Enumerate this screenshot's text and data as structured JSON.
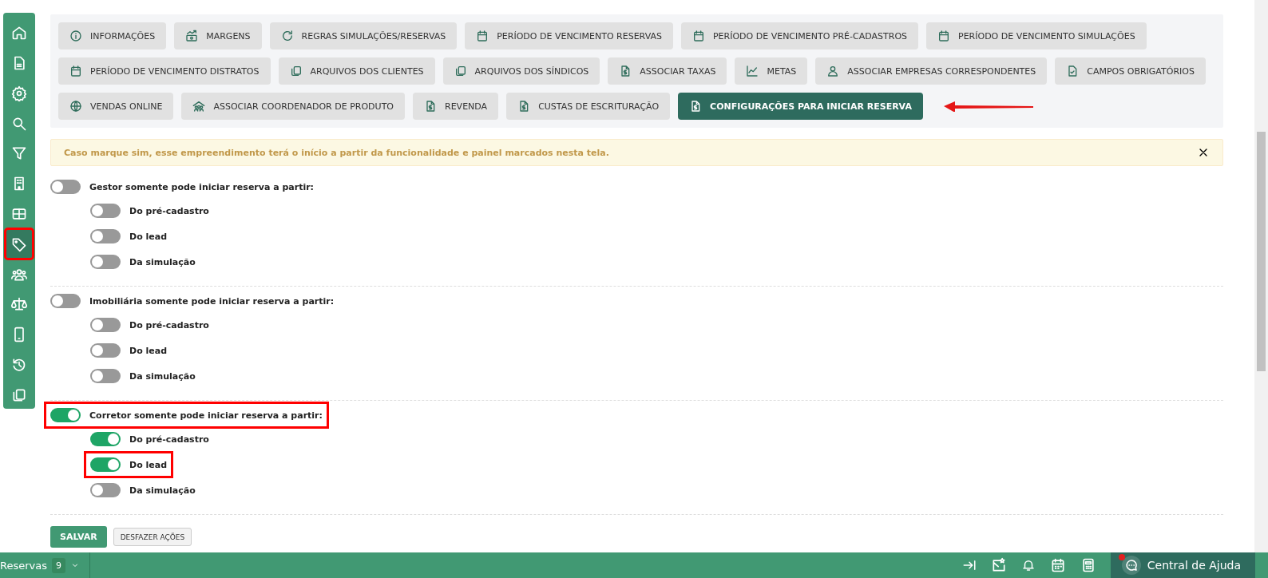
{
  "sidebar": {
    "items": [
      {
        "kind": "home",
        "selected": false,
        "highlighted": false
      },
      {
        "kind": "file",
        "selected": false,
        "highlighted": false
      },
      {
        "kind": "gear",
        "selected": false,
        "highlighted": false
      },
      {
        "kind": "search",
        "selected": false,
        "highlighted": false
      },
      {
        "kind": "filter",
        "selected": false,
        "highlighted": false
      },
      {
        "kind": "building",
        "selected": false,
        "highlighted": false
      },
      {
        "kind": "table",
        "selected": false,
        "highlighted": false
      },
      {
        "kind": "tag",
        "selected": true,
        "highlighted": true
      },
      {
        "kind": "people",
        "selected": false,
        "highlighted": false
      },
      {
        "kind": "scale",
        "selected": false,
        "highlighted": false
      },
      {
        "kind": "phone",
        "selected": false,
        "highlighted": false
      },
      {
        "kind": "history",
        "selected": false,
        "highlighted": false
      },
      {
        "kind": "copy",
        "selected": false,
        "highlighted": false
      }
    ]
  },
  "tabs": [
    {
      "label": "INFORMAÇÕES",
      "kind": "info",
      "selected": false,
      "annotated": false
    },
    {
      "label": "MARGENS",
      "kind": "money",
      "selected": false,
      "annotated": false
    },
    {
      "label": "REGRAS SIMULAÇÕES/RESERVAS",
      "kind": "refresh",
      "selected": false,
      "annotated": false
    },
    {
      "label": "PERÍODO DE VENCIMENTO RESERVAS",
      "kind": "calendar",
      "selected": false,
      "annotated": false
    },
    {
      "label": "PERÍODO DE VENCIMENTO PRÉ-CADASTROS",
      "kind": "calendar",
      "selected": false,
      "annotated": false
    },
    {
      "label": "PERÍODO DE VENCIMENTO SIMULAÇÕES",
      "kind": "calendar",
      "selected": false,
      "annotated": false
    },
    {
      "label": "PERÍODO DE VENCIMENTO DISTRATOS",
      "kind": "calendar",
      "selected": false,
      "annotated": false
    },
    {
      "label": "ARQUIVOS DOS CLIENTES",
      "kind": "copy",
      "selected": false,
      "annotated": false
    },
    {
      "label": "ARQUIVOS DOS SÍNDICOS",
      "kind": "copy",
      "selected": false,
      "annotated": false
    },
    {
      "label": "ASSOCIAR TAXAS",
      "kind": "doc-dollar",
      "selected": false,
      "annotated": false
    },
    {
      "label": "METAS",
      "kind": "chart",
      "selected": false,
      "annotated": false
    },
    {
      "label": "ASSOCIAR EMPRESAS CORRESPONDENTES",
      "kind": "user",
      "selected": false,
      "annotated": false
    },
    {
      "label": "CAMPOS OBRIGATÓRIOS",
      "kind": "doc-check",
      "selected": false,
      "annotated": false
    },
    {
      "label": "VENDAS ONLINE",
      "kind": "globe",
      "selected": false,
      "annotated": false
    },
    {
      "label": "ASSOCIAR COORDENADOR DE PRODUTO",
      "kind": "people-house",
      "selected": false,
      "annotated": false
    },
    {
      "label": "REVENDA",
      "kind": "doc-dollar",
      "selected": false,
      "annotated": false
    },
    {
      "label": "CUSTAS DE ESCRITURAÇÃO",
      "kind": "doc-dollar",
      "selected": false,
      "annotated": false
    },
    {
      "label": "CONFIGURAÇÕES PARA INICIAR RESERVA",
      "kind": "doc-dollar",
      "selected": true,
      "annotated": true
    }
  ],
  "alert": {
    "text": "Caso marque sim, esse empreendimento terá o início a partir da funcionalidade e painel marcados nesta tela."
  },
  "groups": [
    {
      "label": "Gestor somente pode iniciar reserva a partir:",
      "on": false,
      "highlighted": false,
      "options": [
        {
          "label": "Do pré-cadastro",
          "on": false,
          "highlighted": false
        },
        {
          "label": "Do lead",
          "on": false,
          "highlighted": false
        },
        {
          "label": "Da simulação",
          "on": false,
          "highlighted": false
        }
      ]
    },
    {
      "label": "Imobiliária somente pode iniciar reserva a partir:",
      "on": false,
      "highlighted": false,
      "options": [
        {
          "label": "Do pré-cadastro",
          "on": false,
          "highlighted": false
        },
        {
          "label": "Do lead",
          "on": false,
          "highlighted": false
        },
        {
          "label": "Da simulação",
          "on": false,
          "highlighted": false
        }
      ]
    },
    {
      "label": "Corretor somente pode iniciar reserva a partir:",
      "on": true,
      "highlighted": true,
      "options": [
        {
          "label": "Do pré-cadastro",
          "on": true,
          "highlighted": false
        },
        {
          "label": "Do lead",
          "on": true,
          "highlighted": true
        },
        {
          "label": "Da simulação",
          "on": false,
          "highlighted": false
        }
      ]
    }
  ],
  "buttons": {
    "save": "SALVAR",
    "undo": "DESFAZER AÇÕES"
  },
  "status_bar": {
    "module": "Reservas",
    "count": "9",
    "help": "Central de Ajuda"
  }
}
